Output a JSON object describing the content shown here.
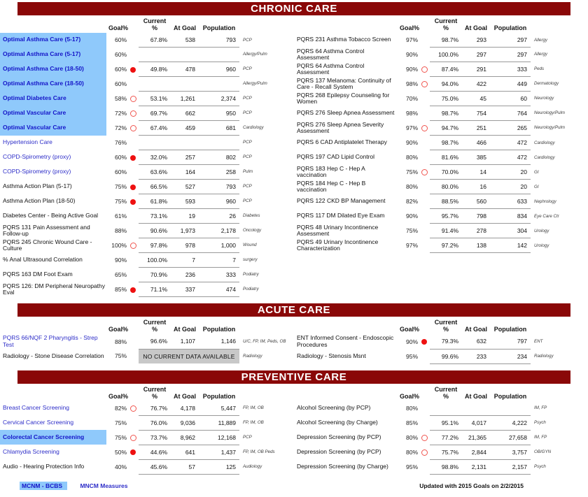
{
  "columns": {
    "label": "",
    "goal": "Goal%",
    "current": "Current %",
    "at_goal": "At Goal",
    "population": "Population",
    "specialty": ""
  },
  "colors": {
    "banner": "#8a0808",
    "highlight": "#8fc9fb",
    "mncm_text": "#2d2dc8",
    "dot_red": "#ee1111",
    "dot_open": "#f0554f",
    "nodata_bg": "#c8c8c8"
  },
  "sections": [
    {
      "title": "CHRONIC CARE",
      "left_rows": [
        {
          "label": "Optimal Asthma Care (5-17)",
          "style": "bcbs",
          "goal": "60%",
          "dot": "none",
          "current": "67.8%",
          "at_goal": "538",
          "population": "793",
          "specialty": "PCP"
        },
        {
          "label": "Optimal Asthma Care (5-17)",
          "style": "bcbs",
          "goal": "60%",
          "dot": "none",
          "current": "",
          "at_goal": "",
          "population": "",
          "specialty": "Allergy/Pulm"
        },
        {
          "label": "Optimal Asthma Care (18-50)",
          "style": "bcbs",
          "goal": "60%",
          "dot": "red",
          "current": "49.8%",
          "at_goal": "478",
          "population": "960",
          "specialty": "PCP"
        },
        {
          "label": "Optimal Asthma Care (18-50)",
          "style": "bcbs",
          "goal": "60%",
          "dot": "none",
          "current": "",
          "at_goal": "",
          "population": "",
          "specialty": "Allergy/Pulm"
        },
        {
          "label": "Optimal Diabetes Care",
          "style": "bcbs",
          "goal": "58%",
          "dot": "open",
          "current": "53.1%",
          "at_goal": "1,261",
          "population": "2,374",
          "specialty": "PCP"
        },
        {
          "label": "Optimal Vascular Care",
          "style": "bcbs",
          "goal": "72%",
          "dot": "open",
          "current": "69.7%",
          "at_goal": "662",
          "population": "950",
          "specialty": "PCP"
        },
        {
          "label": "Optimal Vascular Care",
          "style": "bcbs",
          "goal": "72%",
          "dot": "open",
          "current": "67.4%",
          "at_goal": "459",
          "population": "681",
          "specialty": "Cardiology"
        },
        {
          "label": "Hypertension Care",
          "style": "mncm",
          "goal": "76%",
          "dot": "none",
          "current": "",
          "at_goal": "",
          "population": "",
          "specialty": "PCP"
        },
        {
          "label": "COPD-Spirometry (proxy)",
          "style": "mncm",
          "goal": "60%",
          "dot": "red",
          "current": "32.0%",
          "at_goal": "257",
          "population": "802",
          "specialty": "PCP"
        },
        {
          "label": "COPD-Spirometry (proxy)",
          "style": "mncm",
          "goal": "60%",
          "dot": "none",
          "current": "63.6%",
          "at_goal": "164",
          "population": "258",
          "specialty": "Pulm"
        },
        {
          "label": "Asthma Action Plan (5-17)",
          "style": "plain",
          "goal": "75%",
          "dot": "red",
          "current": "66.5%",
          "at_goal": "527",
          "population": "793",
          "specialty": "PCP"
        },
        {
          "label": "Asthma Action Plan (18-50)",
          "style": "plain",
          "goal": "75%",
          "dot": "red",
          "current": "61.8%",
          "at_goal": "593",
          "population": "960",
          "specialty": "PCP"
        },
        {
          "label": "Diabetes Center - Being Active Goal",
          "style": "plain",
          "goal": "61%",
          "dot": "none",
          "current": "73.1%",
          "at_goal": "19",
          "population": "26",
          "specialty": "Diabetes"
        },
        {
          "label": "PQRS 131 Pain Assessment and Follow-up",
          "style": "plain",
          "goal": "88%",
          "dot": "none",
          "current": "90.6%",
          "at_goal": "1,973",
          "population": "2,178",
          "specialty": "Oncology"
        },
        {
          "label": "PQRS 245 Chronic Wound Care - Culture",
          "style": "plain",
          "goal": "100%",
          "dot": "open",
          "current": "97.8%",
          "at_goal": "978",
          "population": "1,000",
          "specialty": "Wound"
        },
        {
          "label": "% Anal Ultrasound Correlation",
          "style": "plain",
          "goal": "90%",
          "dot": "none",
          "current": "100.0%",
          "at_goal": "7",
          "population": "7",
          "specialty": "surgery"
        },
        {
          "label": "PQRS 163 DM Foot Exam",
          "style": "plain",
          "goal": "65%",
          "dot": "none",
          "current": "70.9%",
          "at_goal": "236",
          "population": "333",
          "specialty": "Podiatry"
        },
        {
          "label": "PQRS 126: DM Peripheral Neuropathy Eval",
          "style": "plain",
          "goal": "85%",
          "dot": "red",
          "current": "71.1%",
          "at_goal": "337",
          "population": "474",
          "specialty": "Podiatry"
        }
      ],
      "right_rows": [
        {
          "label": "PQRS 231 Asthma Tobacco Screen",
          "style": "plain",
          "goal": "97%",
          "dot": "none",
          "current": "98.7%",
          "at_goal": "293",
          "population": "297",
          "specialty": "Allergy"
        },
        {
          "label": "PQRS 64 Asthma Control Assessment",
          "style": "plain",
          "goal": "90%",
          "dot": "none",
          "current": "100.0%",
          "at_goal": "297",
          "population": "297",
          "specialty": "Allergy"
        },
        {
          "label": "PQRS 64 Asthma Control Assessment",
          "style": "plain",
          "goal": "90%",
          "dot": "open",
          "current": "87.4%",
          "at_goal": "291",
          "population": "333",
          "specialty": "Peds"
        },
        {
          "label": "PQRS 137 Melanoma: Continuity of Care - Recall System",
          "style": "plain",
          "goal": "98%",
          "dot": "open",
          "current": "94.0%",
          "at_goal": "422",
          "population": "449",
          "specialty": "Dermatology"
        },
        {
          "label": "PQRS 268 Epilepsy Counseling for Women",
          "style": "plain",
          "goal": "70%",
          "dot": "none",
          "current": "75.0%",
          "at_goal": "45",
          "population": "60",
          "specialty": "Neurology"
        },
        {
          "label": "PQRS 276 Sleep Apnea Assessment",
          "style": "plain",
          "goal": "98%",
          "dot": "none",
          "current": "98.7%",
          "at_goal": "754",
          "population": "764",
          "specialty": "Neurology/Pulm"
        },
        {
          "label": "PQRS 276 Sleep Apnea Severity Assessment",
          "style": "plain",
          "goal": "97%",
          "dot": "open",
          "current": "94.7%",
          "at_goal": "251",
          "population": "265",
          "specialty": "Neurology/Pulm"
        },
        {
          "label": "PQRS 6 CAD Antiplatelet Therapy",
          "style": "plain",
          "goal": "90%",
          "dot": "none",
          "current": "98.7%",
          "at_goal": "466",
          "population": "472",
          "specialty": "Cardiology"
        },
        {
          "label": "PQRS 197 CAD Lipid Control",
          "style": "plain",
          "goal": "80%",
          "dot": "none",
          "current": "81.6%",
          "at_goal": "385",
          "population": "472",
          "specialty": "Cardiology"
        },
        {
          "label": "PQRS 183 Hep C - Hep A vaccination",
          "style": "plain",
          "goal": "75%",
          "dot": "open",
          "current": "70.0%",
          "at_goal": "14",
          "population": "20",
          "specialty": "GI"
        },
        {
          "label": "PQRS 184 Hep C - Hep B vaccination",
          "style": "plain",
          "goal": "80%",
          "dot": "none",
          "current": "80.0%",
          "at_goal": "16",
          "population": "20",
          "specialty": "GI"
        },
        {
          "label": "PQRS 122 CKD BP Management",
          "style": "plain",
          "goal": "82%",
          "dot": "none",
          "current": "88.5%",
          "at_goal": "560",
          "population": "633",
          "specialty": "Nephrology"
        },
        {
          "label": "PQRS 117 DM Dilated Eye Exam",
          "style": "plain",
          "goal": "90%",
          "dot": "none",
          "current": "95.7%",
          "at_goal": "798",
          "population": "834",
          "specialty": "Eye Care Ctr"
        },
        {
          "label": "PQRS 48 Urinary Incontinence Assessment",
          "style": "plain",
          "goal": "75%",
          "dot": "none",
          "current": "91.4%",
          "at_goal": "278",
          "population": "304",
          "specialty": "Urology"
        },
        {
          "label": "PQRS 49 Urinary Incontinence Characterization",
          "style": "plain",
          "goal": "97%",
          "dot": "none",
          "current": "97.2%",
          "at_goal": "138",
          "population": "142",
          "specialty": "Urology"
        }
      ]
    },
    {
      "title": "ACUTE CARE",
      "left_rows": [
        {
          "label": "PQRS 66/NQF 2 Pharyngitis - Strep Test",
          "style": "mncm",
          "goal": "88%",
          "dot": "none",
          "current": "96.6%",
          "at_goal": "1,107",
          "population": "1,146",
          "specialty": "U/C, FP, IM, Peds, OB"
        },
        {
          "label": "Radiology - Stone Disease Correlation",
          "style": "plain",
          "goal": "75%",
          "dot": "none",
          "nodata": "NO CURRENT DATA AVAILABLE",
          "specialty": "Radiology"
        }
      ],
      "right_rows": [
        {
          "label": "ENT Informed Consent - Endoscopic Procedures",
          "style": "plain",
          "goal": "90%",
          "dot": "red",
          "current": "79.3%",
          "at_goal": "632",
          "population": "797",
          "specialty": "ENT"
        },
        {
          "label": "Radiology - Stenosis Msnt",
          "style": "plain",
          "goal": "95%",
          "dot": "none",
          "current": "99.6%",
          "at_goal": "233",
          "population": "234",
          "specialty": "Radiology"
        }
      ]
    },
    {
      "title": "PREVENTIVE CARE",
      "left_rows": [
        {
          "label": "Breast Cancer Screening",
          "style": "mncm",
          "goal": "82%",
          "dot": "open",
          "current": "76.7%",
          "at_goal": "4,178",
          "population": "5,447",
          "specialty": "FP, IM, OB"
        },
        {
          "label": "Cervical Cancer Screening",
          "style": "mncm",
          "goal": "75%",
          "dot": "none",
          "current": "76.0%",
          "at_goal": "9,036",
          "population": "11,889",
          "specialty": "FP, IM, OB"
        },
        {
          "label": "Colorectal Cancer Screening",
          "style": "bcbs",
          "goal": "75%",
          "dot": "open",
          "current": "73.7%",
          "at_goal": "8,962",
          "population": "12,168",
          "specialty": "PCP"
        },
        {
          "label": "Chlamydia Screening",
          "style": "mncm",
          "goal": "50%",
          "dot": "red",
          "current": "44.6%",
          "at_goal": "641",
          "population": "1,437",
          "specialty": "FP, IM, OB Peds"
        },
        {
          "label": "Audio - Hearing Protection Info",
          "style": "plain",
          "goal": "40%",
          "dot": "none",
          "current": "45.6%",
          "at_goal": "57",
          "population": "125",
          "specialty": "Audiology"
        }
      ],
      "right_rows": [
        {
          "label": "Alcohol Screening (by PCP)",
          "style": "plain",
          "goal": "80%",
          "dot": "none",
          "current": "",
          "at_goal": "",
          "population": "",
          "specialty": "IM, FP"
        },
        {
          "label": "Alcohol Screening (by Charge)",
          "style": "plain",
          "goal": "85%",
          "dot": "none",
          "current": "95.1%",
          "at_goal": "4,017",
          "population": "4,222",
          "specialty": "Psych"
        },
        {
          "label": "Depression Screening (by PCP)",
          "style": "plain",
          "goal": "80%",
          "dot": "open",
          "current": "77.2%",
          "at_goal": "21,365",
          "population": "27,658",
          "specialty": "IM, FP"
        },
        {
          "label": "Depression Screening (by PCP)",
          "style": "plain",
          "goal": "80%",
          "dot": "open",
          "current": "75.7%",
          "at_goal": "2,844",
          "population": "3,757",
          "specialty": "OB/GYN"
        },
        {
          "label": "Depression Screening (by Charge)",
          "style": "plain",
          "goal": "95%",
          "dot": "none",
          "current": "98.8%",
          "at_goal": "2,131",
          "population": "2,157",
          "specialty": "Psych"
        }
      ]
    }
  ],
  "legend": {
    "chip": "MCNM - BCBS",
    "text": "MNCM Measures"
  },
  "footer": {
    "updated": "Updated with 2015 Goals on 2/2/2015"
  }
}
